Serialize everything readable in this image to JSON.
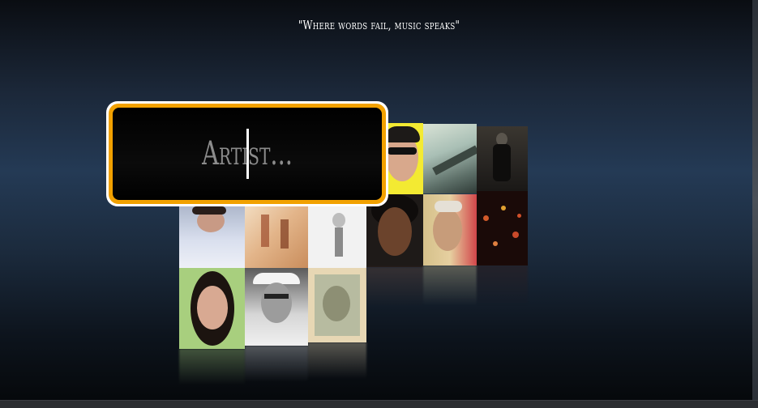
{
  "quote": "\"Where words fail, music speaks\"",
  "search": {
    "placeholder": "Artist..."
  },
  "colors": {
    "accent": "#f2a100",
    "border": "#ffffff",
    "input_bg": "#000000"
  },
  "icons": [
    "text-caret"
  ],
  "wall": {
    "tiles": [
      {
        "name": "album-yellow-sunglasses"
      },
      {
        "name": "album-road-teal"
      },
      {
        "name": "album-dark-figure"
      },
      {
        "name": "album-pillow-face"
      },
      {
        "name": "album-sepia-figures"
      },
      {
        "name": "album-white-sketch"
      },
      {
        "name": "album-dark-face-afro"
      },
      {
        "name": "album-pop-art-face"
      },
      {
        "name": "album-bokeh-lights"
      },
      {
        "name": "album-woman-green"
      },
      {
        "name": "album-man-hat-bw"
      },
      {
        "name": "album-vintage-face"
      }
    ]
  }
}
